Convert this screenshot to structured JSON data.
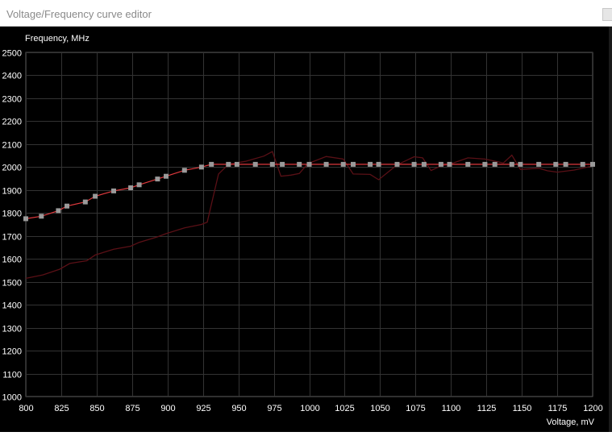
{
  "window": {
    "title": "Voltage/Frequency curve editor"
  },
  "chart_data": {
    "type": "line",
    "ylabel": "Frequency, MHz",
    "xlabel": "Voltage, mV",
    "xlim": [
      800,
      1200
    ],
    "ylim": [
      1000,
      2500
    ],
    "x_ticks": [
      800,
      825,
      850,
      875,
      900,
      925,
      950,
      975,
      1000,
      1025,
      1050,
      1075,
      1100,
      1125,
      1150,
      1175,
      1200
    ],
    "y_ticks": [
      1000,
      1100,
      1200,
      1300,
      1400,
      1500,
      1600,
      1700,
      1800,
      1900,
      2000,
      2100,
      2200,
      2300,
      2400,
      2500
    ],
    "grid": true,
    "colors": {
      "curve": "#e0393d",
      "points": "#9a9a9a",
      "monitor": "#5a1016",
      "grid": "#333333",
      "background": "#000000"
    },
    "series": [
      {
        "points": [
          [
            800,
            1775
          ],
          [
            811,
            1786
          ],
          [
            823,
            1810
          ],
          [
            829,
            1830
          ],
          [
            842,
            1848
          ],
          [
            849,
            1873
          ],
          [
            862,
            1896
          ],
          [
            874,
            1910
          ],
          [
            880,
            1923
          ],
          [
            893,
            1948
          ],
          [
            899,
            1960
          ],
          [
            912,
            1986
          ],
          [
            924,
            2000
          ],
          [
            931,
            2012
          ],
          [
            943,
            2012
          ],
          [
            949,
            2012
          ],
          [
            962,
            2012
          ],
          [
            974,
            2012
          ],
          [
            981,
            2012
          ],
          [
            993,
            2012
          ],
          [
            1000,
            2012
          ],
          [
            1012,
            2012
          ],
          [
            1024,
            2012
          ],
          [
            1031,
            2012
          ],
          [
            1043,
            2012
          ],
          [
            1049,
            2012
          ],
          [
            1062,
            2012
          ],
          [
            1074,
            2012
          ],
          [
            1081,
            2012
          ],
          [
            1093,
            2012
          ],
          [
            1099,
            2012
          ],
          [
            1112,
            2012
          ],
          [
            1124,
            2012
          ],
          [
            1131,
            2012
          ],
          [
            1143,
            2012
          ],
          [
            1149,
            2012
          ],
          [
            1162,
            2012
          ],
          [
            1174,
            2012
          ],
          [
            1181,
            2012
          ],
          [
            1193,
            2012
          ],
          [
            1200,
            2012
          ]
        ]
      },
      {
        "points": [
          [
            800,
            1515
          ],
          [
            812,
            1530
          ],
          [
            824,
            1555
          ],
          [
            831,
            1580
          ],
          [
            843,
            1592
          ],
          [
            849,
            1617
          ],
          [
            862,
            1642
          ],
          [
            874,
            1655
          ],
          [
            880,
            1672
          ],
          [
            893,
            1696
          ],
          [
            899,
            1710
          ],
          [
            912,
            1735
          ],
          [
            924,
            1750
          ],
          [
            928,
            1760
          ],
          [
            936,
            1970
          ],
          [
            943,
            2012
          ],
          [
            955,
            2025
          ],
          [
            968,
            2048
          ],
          [
            974,
            2068
          ],
          [
            980,
            1960
          ],
          [
            987,
            1965
          ],
          [
            993,
            1972
          ],
          [
            999,
            2015
          ],
          [
            1012,
            2046
          ],
          [
            1024,
            2035
          ],
          [
            1031,
            1970
          ],
          [
            1043,
            1968
          ],
          [
            1049,
            1945
          ],
          [
            1062,
            2010
          ],
          [
            1074,
            2045
          ],
          [
            1080,
            2040
          ],
          [
            1086,
            1985
          ],
          [
            1093,
            2005
          ],
          [
            1099,
            2012
          ],
          [
            1112,
            2040
          ],
          [
            1124,
            2035
          ],
          [
            1137,
            2018
          ],
          [
            1143,
            2052
          ],
          [
            1149,
            1990
          ],
          [
            1162,
            1995
          ],
          [
            1168,
            1984
          ],
          [
            1175,
            1978
          ],
          [
            1187,
            1987
          ],
          [
            1200,
            2005
          ]
        ]
      }
    ]
  }
}
